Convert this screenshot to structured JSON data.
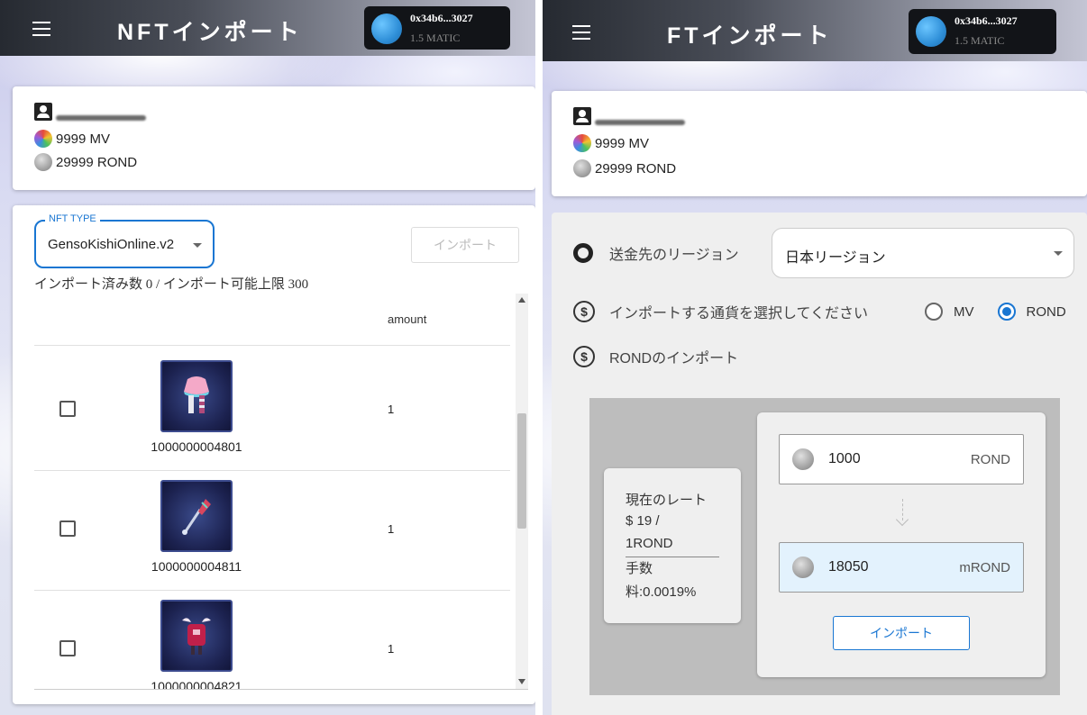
{
  "left_panel": {
    "header": {
      "title": "NFTインポート",
      "wallet": {
        "address": "0x34b6...3027",
        "balance": "1.5 MATIC"
      }
    },
    "user": {
      "mv_balance": "9999 MV",
      "rond_balance": "29999 ROND"
    },
    "nft_type": {
      "legend": "NFT TYPE",
      "value": "GensoKishiOnline.v2"
    },
    "import_button": "インポート",
    "count_text": "インポート済み数 0 / インポート可能上限 300",
    "table": {
      "amount_header": "amount",
      "rows": [
        {
          "id": "1000000004801",
          "amount": "1"
        },
        {
          "id": "1000000004811",
          "amount": "1"
        },
        {
          "id": "1000000004821",
          "amount": "1"
        }
      ]
    }
  },
  "right_panel": {
    "header": {
      "title": "FTインポート",
      "wallet": {
        "address": "0x34b6...3027",
        "balance": "1.5 MATIC"
      }
    },
    "user": {
      "mv_balance": "9999 MV",
      "rond_balance": "29999 ROND"
    },
    "region": {
      "label": "送金先のリージョン",
      "value": "日本リージョン"
    },
    "currency": {
      "label": "インポートする通貨を選択してください",
      "options": [
        "MV",
        "ROND"
      ],
      "selected": "ROND"
    },
    "section_title": "RONDのインポート",
    "rate": {
      "line1": "現在のレート",
      "line2": "$ 19 /",
      "line3": "1ROND",
      "line4": "手数",
      "line5": "料:0.0019%"
    },
    "from": {
      "value": "1000",
      "unit": "ROND"
    },
    "to": {
      "value": "18050",
      "unit": "mROND"
    },
    "import_button": "インポート"
  },
  "colors": {
    "accent": "#1976d2",
    "header_dark": "#262a31",
    "conv_bg": "#bdbdbd",
    "to_bg": "#e3f2fd"
  }
}
